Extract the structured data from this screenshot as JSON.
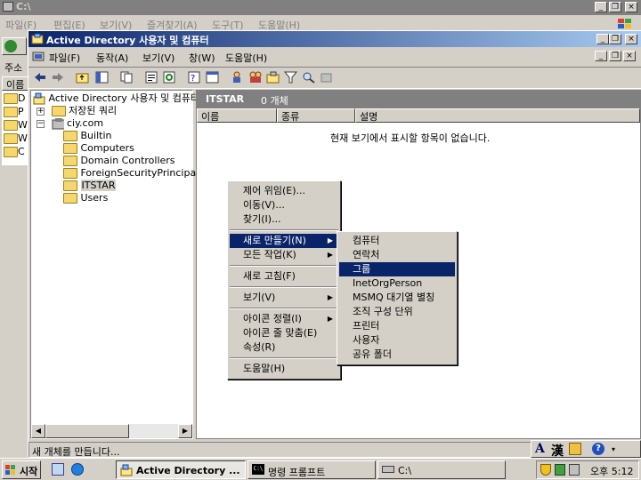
{
  "outer_window": {
    "title": "C:\\",
    "menu": [
      "파일(F)",
      "편집(E)",
      "보기(V)",
      "즐겨찾기(A)",
      "도구(T)",
      "도움말(H)"
    ],
    "address_label": "주소",
    "list_header": "이름",
    "left_items": [
      "D",
      "P",
      "W",
      "W",
      "C"
    ]
  },
  "mmc": {
    "title": "Active Directory 사용자 및 컴퓨터",
    "menu": [
      "파일(F)",
      "동작(A)",
      "보기(V)",
      "창(W)",
      "도움말(H)"
    ],
    "tree": {
      "root": "Active Directory 사용자 및 컴퓨터",
      "saved_queries": "저장된 쿼리",
      "domain": "ciy.com",
      "children": [
        "Builtin",
        "Computers",
        "Domain Controllers",
        "ForeignSecurityPrincipals",
        "ITSTAR",
        "Users"
      ]
    },
    "details": {
      "title": "ITSTAR",
      "count": "0 개체",
      "columns": [
        "이름",
        "종류",
        "설명"
      ],
      "empty_message": "현재 보기에서 표시할 항목이 없습니다."
    },
    "status": "새 개체를 만듭니다..."
  },
  "context_menu": {
    "items": [
      "제어 위임(E)...",
      "이동(V)...",
      "찾기(I)...",
      "새로 만들기(N)",
      "모든 작업(K)",
      "새로 고침(F)",
      "보기(V)",
      "아이콘 정렬(I)",
      "아이콘 줄 맞춤(E)",
      "속성(R)",
      "도움말(H)"
    ]
  },
  "submenu": {
    "items": [
      "컴퓨터",
      "연락처",
      "그룹",
      "InetOrgPerson",
      "MSMQ 대기열 별칭",
      "조직 구성 단위",
      "프린터",
      "사용자",
      "공유 폴더"
    ],
    "selected_index": 2
  },
  "taskbar": {
    "start": "시작",
    "tasks": [
      "Active Directory ...",
      "명령 프롬프트",
      "C:\\"
    ],
    "clock": "오후 5:12"
  },
  "ime": {
    "lang": "A",
    "hanja": "漢"
  },
  "colors": {
    "selection": "#0a246a",
    "title_active": "#0a246a",
    "header_gray": "#808080"
  }
}
